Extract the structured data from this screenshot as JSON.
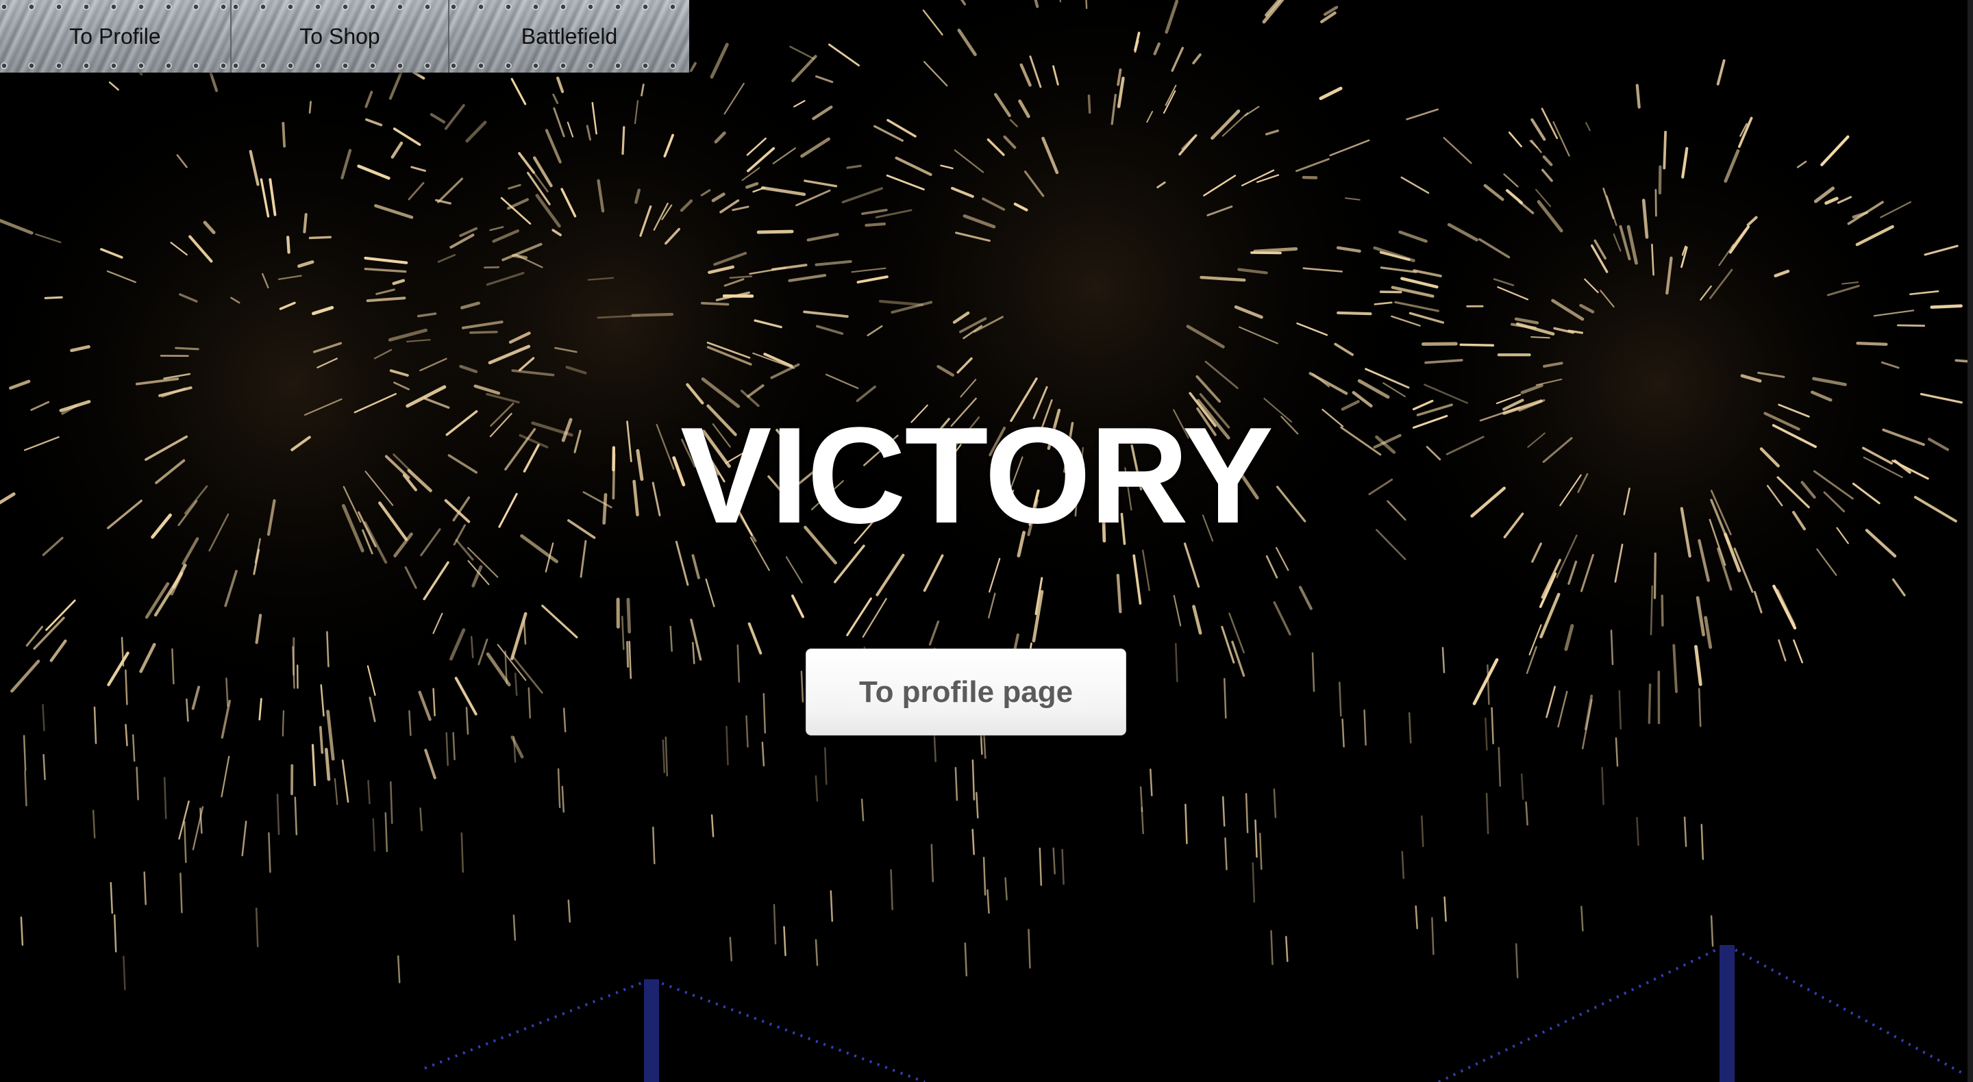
{
  "nav": {
    "items": [
      {
        "label": "To Profile"
      },
      {
        "label": "To Shop"
      },
      {
        "label": "Battlefield"
      }
    ]
  },
  "hero": {
    "title": "VICTORY",
    "button_label": "To profile page"
  },
  "background": {
    "description_icon": "fireworks-image",
    "color_spark": "#f2d7a6",
    "color_sky": "#000000",
    "color_bridge_lights": "#3b4bd8"
  }
}
